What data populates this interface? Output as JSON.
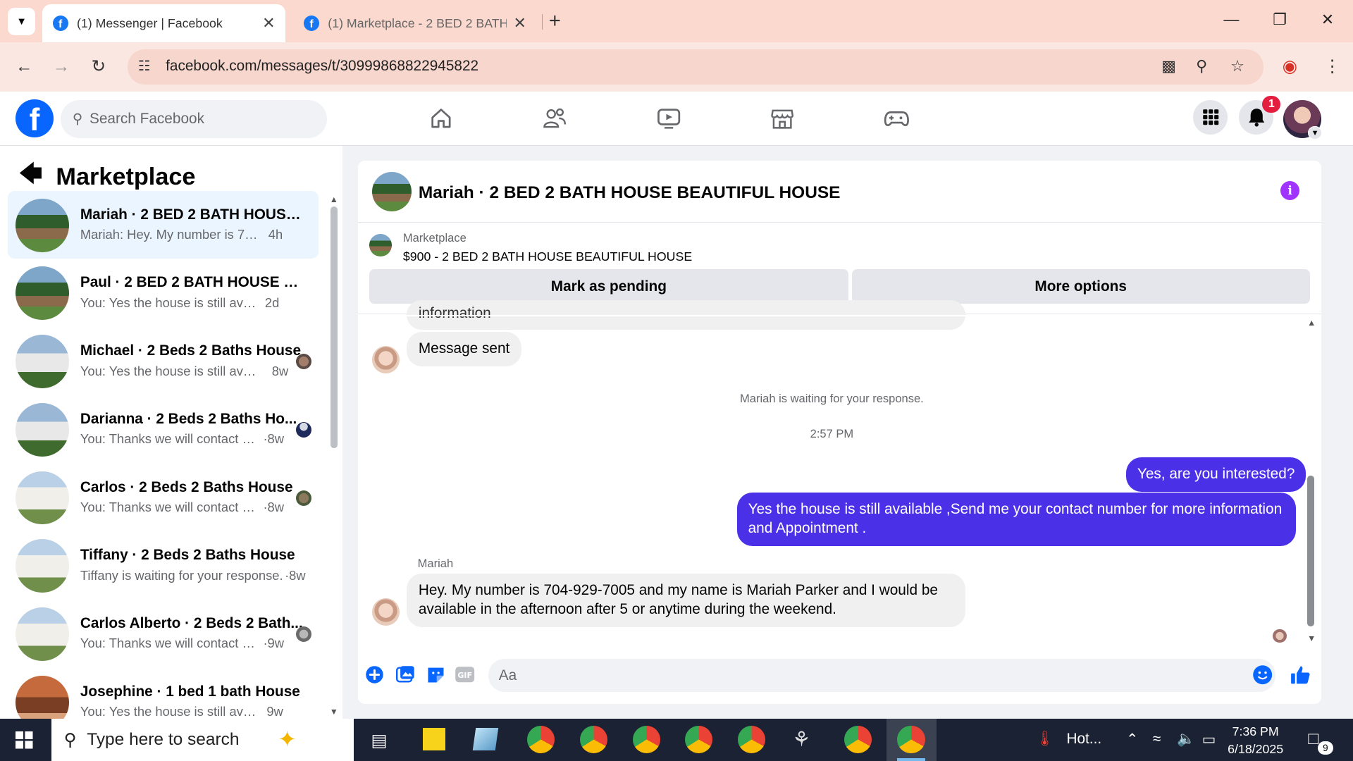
{
  "browser": {
    "tabs": [
      {
        "title": "(1) Messenger | Facebook",
        "active": true
      },
      {
        "title": "(1) Marketplace - 2 BED 2 BATH",
        "active": false
      }
    ],
    "url": "facebook.com/messages/t/30999868822945822"
  },
  "fb": {
    "search_placeholder": "Search Facebook",
    "notification_count": "1"
  },
  "sidebar": {
    "title": "Marketplace",
    "conversations": [
      {
        "name": "Mariah · 2 BED 2 BATH HOUSE ...",
        "preview": "Mariah: Hey. My number is 704-92...",
        "time": "4h"
      },
      {
        "name": "Paul · 2 BED 2 BATH HOUSE BEA...",
        "preview": "You: Yes the house is still available ,...",
        "time": "2d"
      },
      {
        "name": "Michael · 2 Beds 2 Baths House",
        "preview": "You: Yes the house is still availa...",
        "time": "8w"
      },
      {
        "name": "Darianna · 2 Beds 2 Baths Ho...",
        "preview": "You: Thanks we will contact you...",
        "time": "·8w"
      },
      {
        "name": "Carlos · 2 Beds 2 Baths House",
        "preview": "You: Thanks we will contact you...",
        "time": "·8w"
      },
      {
        "name": "Tiffany · 2 Beds 2 Baths House",
        "preview": "Tiffany is waiting for your response.",
        "time": "·8w"
      },
      {
        "name": "Carlos Alberto · 2 Beds 2 Bath...",
        "preview": "You: Thanks we will contact you...",
        "time": "·9w"
      },
      {
        "name": "Josephine · 1 bed 1 bath House",
        "preview": "You: Yes the house is still available ...",
        "time": "9w"
      }
    ]
  },
  "chat": {
    "title": "Mariah · 2 BED 2 BATH HOUSE BEAUTIFUL HOUSE",
    "listing_label": "Marketplace",
    "listing_price_title": "$900 - 2 BED 2 BATH HOUSE BEAUTIFUL HOUSE",
    "mark_pending": "Mark as pending",
    "more_options": "More options",
    "cut_bubble": "information",
    "message_sent": "Message sent",
    "waiting_note": "Mariah is waiting for your response.",
    "timestamp": "2:57 PM",
    "out_msg_1": "Yes, are you interested?",
    "out_msg_2": "Yes the house is still available ,Send me your contact number for more information and Appointment .",
    "sender_name": "Mariah",
    "in_msg": "Hey. My number is 704-929-7005 and my name is Mariah Parker and I would be available in the afternoon after 5 or anytime during the weekend.",
    "composer_placeholder": "Aa"
  },
  "taskbar": {
    "search_placeholder": "Type here to search",
    "weather": "Hot...",
    "time": "7:36 PM",
    "date": "6/18/2025",
    "notif_count": "9"
  }
}
